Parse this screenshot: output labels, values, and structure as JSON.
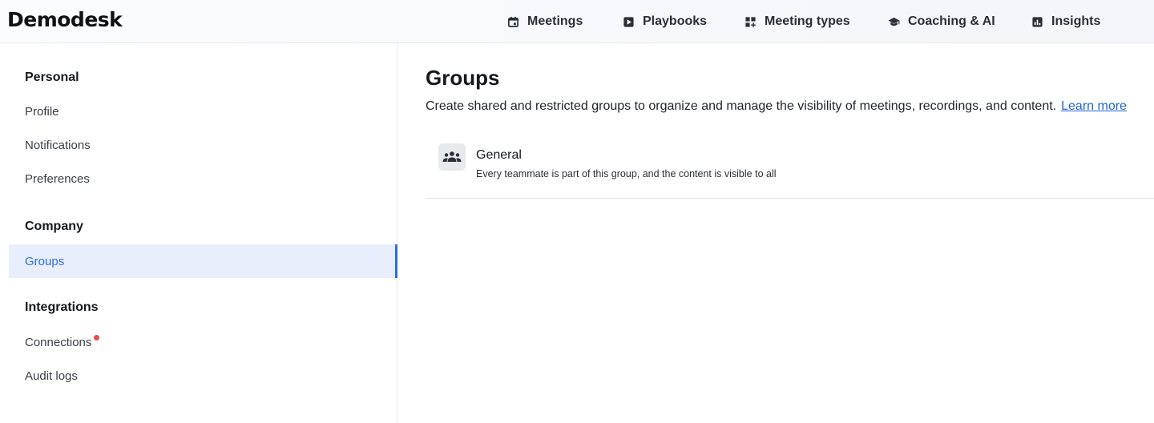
{
  "app": {
    "logo": "Demodesk"
  },
  "nav": [
    {
      "label": "Meetings",
      "icon": "calendar-icon"
    },
    {
      "label": "Playbooks",
      "icon": "play-square-icon"
    },
    {
      "label": "Meeting types",
      "icon": "grid-add-icon"
    },
    {
      "label": "Coaching & AI",
      "icon": "graduation-cap-icon"
    },
    {
      "label": "Insights",
      "icon": "bar-chart-icon"
    }
  ],
  "sidebar": {
    "sections": [
      {
        "title": "Personal",
        "items": [
          {
            "label": "Profile"
          },
          {
            "label": "Notifications"
          },
          {
            "label": "Preferences"
          }
        ]
      },
      {
        "title": "Company",
        "items": [
          {
            "label": "Groups",
            "active": true
          }
        ]
      },
      {
        "title": "Integrations",
        "items": [
          {
            "label": "Connections",
            "badge": "red-dot"
          },
          {
            "label": "Audit logs"
          }
        ]
      }
    ]
  },
  "main": {
    "title": "Groups",
    "description": "Create shared and restricted groups to organize and manage the visibility of meetings, recordings, and content.",
    "learn_more": "Learn more",
    "groups": [
      {
        "name": "General",
        "description": "Every teammate is part of this group, and the content is visible to all",
        "icon": "group-people-icon"
      }
    ]
  },
  "colors": {
    "accent": "#2a6ee0",
    "active_bg": "#e8eefb",
    "badge": "#e94b4b"
  }
}
